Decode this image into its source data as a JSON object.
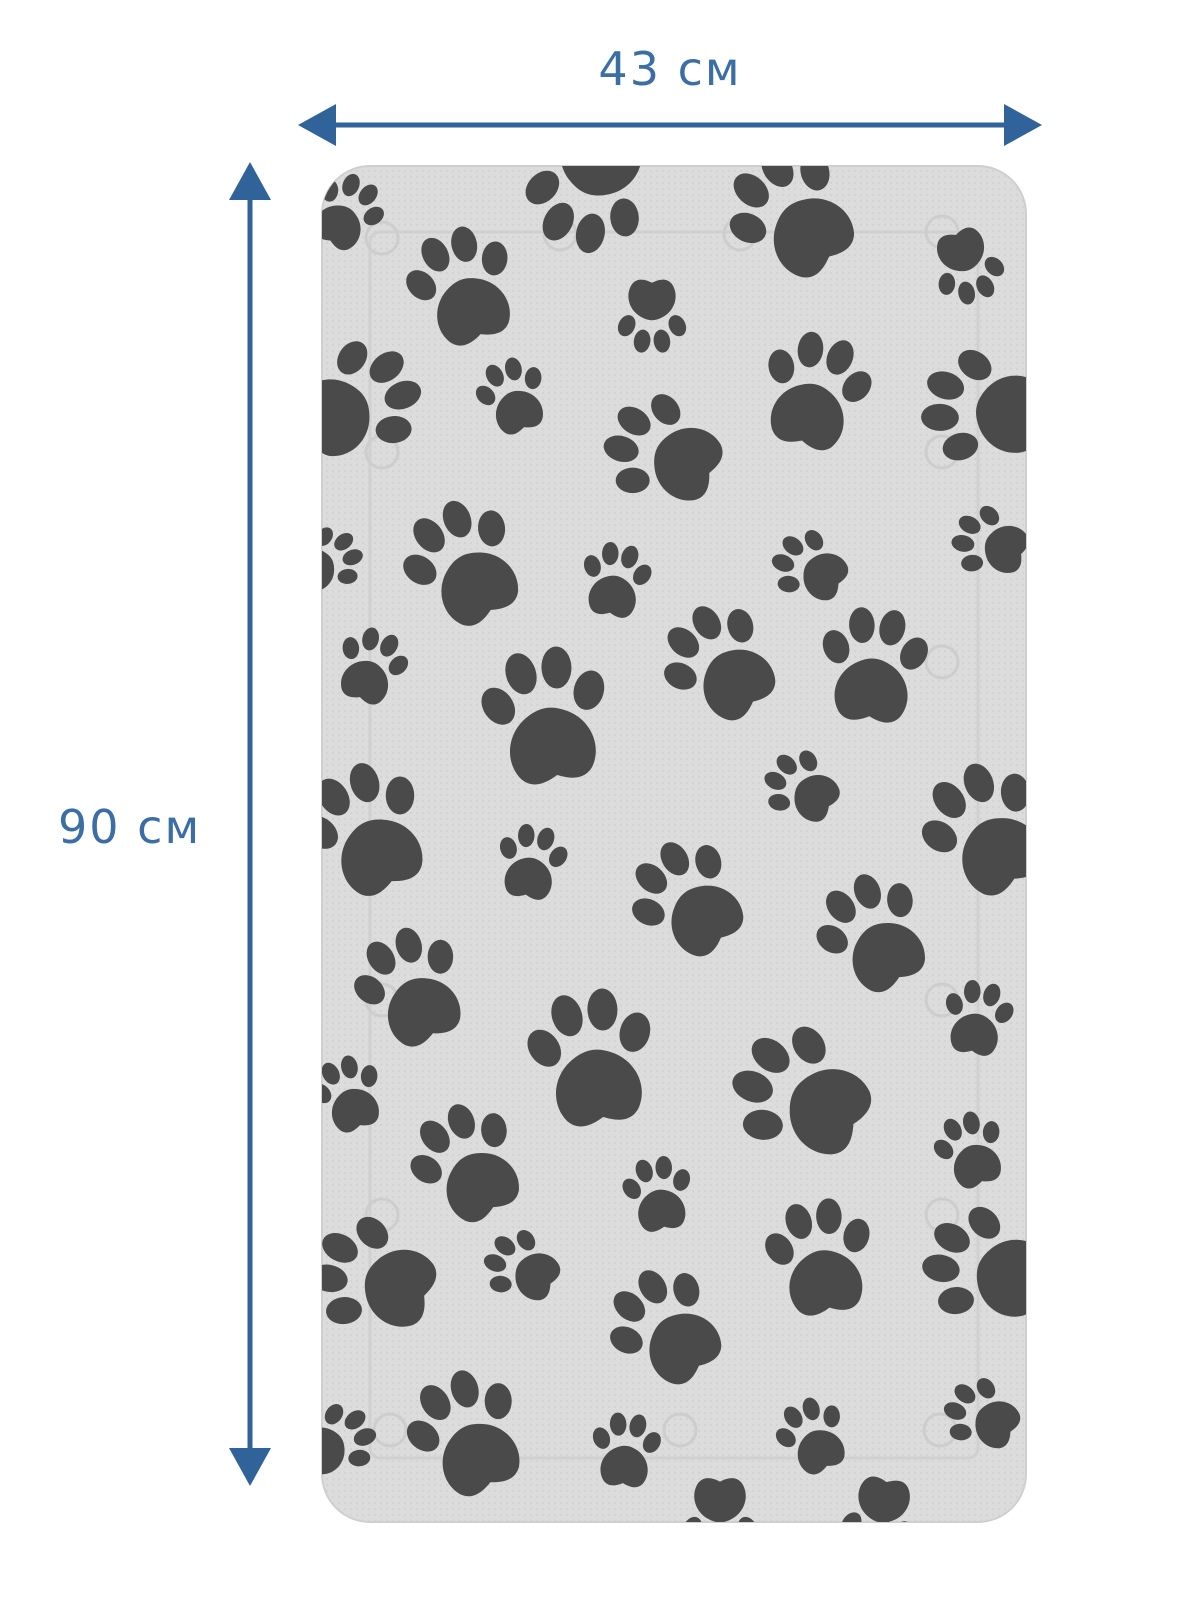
{
  "dimensions": {
    "width_label": "43 см",
    "height_label": "90 см"
  },
  "colors": {
    "arrow": "#2f6399",
    "label": "#3a6ea5",
    "mat": "#dadada",
    "mat_edge": "#cfcfcf",
    "paw": "#4a4a4a"
  },
  "icons": {
    "paw_print": "paw-print-icon",
    "arrow_horizontal": "double-arrow-horizontal-icon",
    "arrow_vertical": "double-arrow-vertical-icon"
  }
}
